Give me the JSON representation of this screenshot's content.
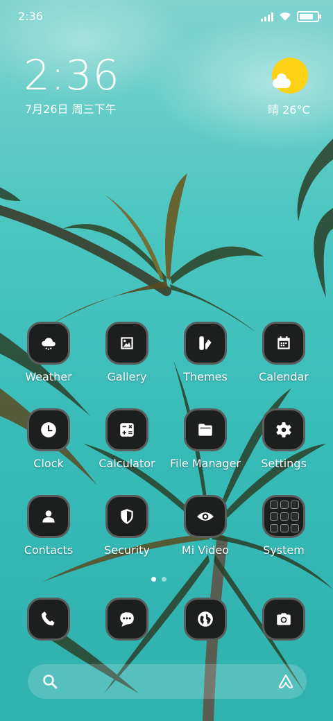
{
  "status_bar": {
    "time": "2:36",
    "battery_level": 0.8
  },
  "clock_widget": {
    "time": "2:36",
    "date": "7月26日 周三下午"
  },
  "weather_widget": {
    "text": "晴 26°C",
    "icon": "sun-cloud-icon"
  },
  "apps": [
    {
      "label": "Weather",
      "icon": "weather-cloud-icon"
    },
    {
      "label": "Gallery",
      "icon": "gallery-icon"
    },
    {
      "label": "Themes",
      "icon": "themes-brush-icon"
    },
    {
      "label": "Calendar",
      "icon": "calendar-icon"
    },
    {
      "label": "Clock",
      "icon": "clock-icon"
    },
    {
      "label": "Calculator",
      "icon": "calculator-icon"
    },
    {
      "label": "File Manager",
      "icon": "folder-icon"
    },
    {
      "label": "Settings",
      "icon": "gear-icon"
    },
    {
      "label": "Contacts",
      "icon": "person-icon"
    },
    {
      "label": "Security",
      "icon": "shield-icon"
    },
    {
      "label": "Mi Video",
      "icon": "eye-icon"
    },
    {
      "label": "System",
      "icon": "folder-grid-icon"
    }
  ],
  "page_indicator": {
    "pages": 2,
    "current": 1
  },
  "dock": [
    {
      "icon": "phone-icon"
    },
    {
      "icon": "message-icon"
    },
    {
      "icon": "globe-icon"
    },
    {
      "icon": "camera-icon"
    }
  ],
  "search_bar": {
    "left_icon": "search-icon",
    "right_icon": "assistant-icon"
  },
  "colors": {
    "sky": "#3fc1bd",
    "icon_bg": "#1d1f1e",
    "icon_ring": "#5a5d5b",
    "sun": "#fcd116"
  }
}
